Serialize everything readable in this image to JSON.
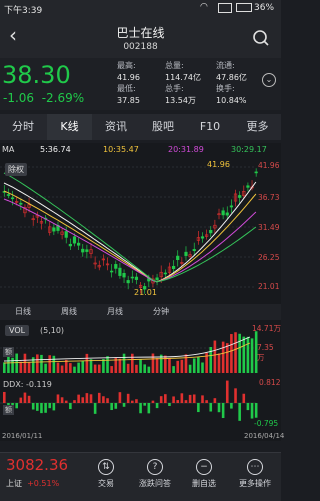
{
  "status": {
    "time": "下午3:39",
    "battery": "36%"
  },
  "header": {
    "title": "巴士在线",
    "code": "002188"
  },
  "quote": {
    "price": "38.30",
    "change": "-1.06",
    "change_pct": "-2.69%",
    "high_lbl": "最高:",
    "high": "41.96",
    "low_lbl": "最低:",
    "low": "37.85",
    "volume_lbl": "总量:",
    "volume": "114.74亿",
    "total_lbl": "总手:",
    "total": "13.54万",
    "float_lbl": "流通:",
    "float": "47.86亿",
    "turnover_lbl": "换手:",
    "turnover": "10.84%"
  },
  "tabs": [
    "分时",
    "K线",
    "资讯",
    "股吧",
    "F10",
    "更多"
  ],
  "ma": {
    "label": "MA",
    "ma5": "5:36.74",
    "ma10": "10:35.47",
    "ma20": "20:31.89",
    "ma30": "30:29.17"
  },
  "chart": {
    "badge": "除权",
    "max_marker": "41.96",
    "min_marker": "21.01",
    "y_ticks": [
      "41.96",
      "36.73",
      "31.49",
      "26.25",
      "21.01"
    ],
    "colors": {
      "up": "#e0302f",
      "down": "#20c94a",
      "ma5": "#f2f2f2",
      "ma10": "#f0c33c",
      "ma20": "#d04bd8",
      "ma30": "#35c45a"
    }
  },
  "period_tabs": [
    "日线",
    "周线",
    "月线",
    "分钟"
  ],
  "volume": {
    "label": "VOL",
    "params": "(5,10)",
    "ticks": [
      "14.71万",
      "7.35万"
    ],
    "badge": "额"
  },
  "ddx": {
    "label": "DDX: -0.119",
    "max": "0.812",
    "min": "-0.795",
    "badge": "额"
  },
  "dates": {
    "start": "2016/01/11",
    "end": "2016/04/14"
  },
  "bottom": {
    "index_value": "3082.36",
    "index_name": "上证",
    "index_change": "+0.51%",
    "nav": [
      "交易",
      "涨跌问答",
      "删自选",
      "更多操作"
    ]
  }
}
